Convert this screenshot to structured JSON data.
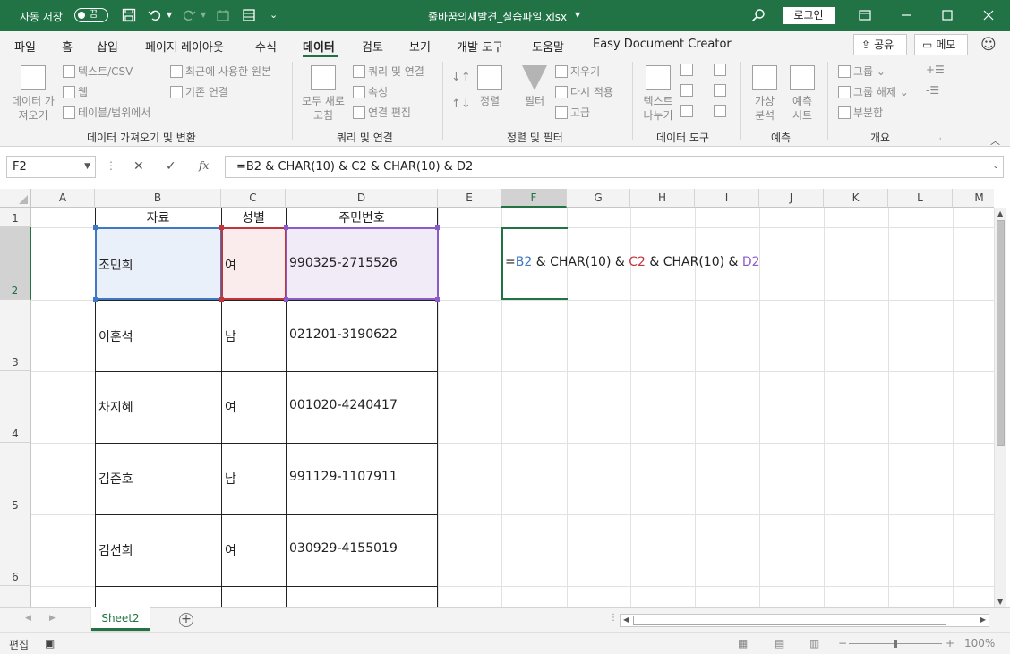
{
  "titlebar": {
    "autosave_label": "자동 저장",
    "autosave_state": "끔",
    "file_title": "줄바꿈의재발견_실습파일.xlsx",
    "login_label": "로그인"
  },
  "tabs": [
    "파일",
    "홈",
    "삽입",
    "페이지 레이아웃",
    "수식",
    "데이터",
    "검토",
    "보기",
    "개발 도구",
    "도움말",
    "Easy Document Creator"
  ],
  "active_tab": "데이터",
  "share_label": "공유",
  "memo_label": "메모",
  "ribbon": {
    "get_data_big": [
      "데이터 가",
      "져오기"
    ],
    "from_text_csv": "텍스트/CSV",
    "from_web": "웹",
    "from_table_range": "테이블/범위에서",
    "recent_sources": "최근에 사용한 원본",
    "existing_connections": "기존 연결",
    "group_get_transform": "데이터 가져오기 및 변환",
    "refresh_all_big": [
      "모두 새로",
      "고침"
    ],
    "queries_connections": "쿼리 및 연결",
    "properties": "속성",
    "edit_links": "연결 편집",
    "group_queries": "쿼리 및 연결",
    "sort_big": "정렬",
    "filter_big": "필터",
    "clear": "지우기",
    "reapply": "다시 적용",
    "advanced": "고급",
    "group_sort_filter": "정렬 및 필터",
    "text_to_columns_big": [
      "텍스트",
      "나누기"
    ],
    "group_data_tools": "데이터 도구",
    "what_if_big": [
      "가상",
      "분석"
    ],
    "forecast_sheet_big": [
      "예측",
      "시트"
    ],
    "group_forecast": "예측",
    "group_btn": "그룹",
    "ungroup_btn": "그룹 해제",
    "subtotal_btn": "부분합",
    "group_outline": "개요"
  },
  "formula_bar": {
    "name_box": "F2",
    "formula": "=B2 & CHAR(10) & C2 & CHAR(10) & D2"
  },
  "columns": [
    "A",
    "B",
    "C",
    "D",
    "E",
    "F",
    "G",
    "H",
    "I",
    "J",
    "K",
    "L",
    "M"
  ],
  "rows": [
    "1",
    "2",
    "3",
    "4",
    "5",
    "6"
  ],
  "table": {
    "headers": [
      "자료",
      "성별",
      "주민번호"
    ],
    "records": [
      [
        "조민희",
        "여",
        "990325-2715526"
      ],
      [
        "이훈석",
        "남",
        "021201-3190622"
      ],
      [
        "차지혜",
        "여",
        "001020-4240417"
      ],
      [
        "김준호",
        "남",
        "991129-1107911"
      ],
      [
        "김선희",
        "여",
        "030929-4155019"
      ]
    ]
  },
  "edit_formula_parts": {
    "eq": "=",
    "ref_b": "B2",
    "sep1": " & CHAR(10) & ",
    "ref_c": "C2",
    "sep2": " & CHAR(10) & ",
    "ref_d": "D2"
  },
  "sheet_tab": "Sheet2",
  "status": {
    "mode": "편집",
    "zoom": "100%"
  },
  "colors": {
    "excel_green": "#217346",
    "ref_b2": "#3f78c3",
    "ref_c2": "#c0363b",
    "ref_d2": "#8b5cc7"
  }
}
